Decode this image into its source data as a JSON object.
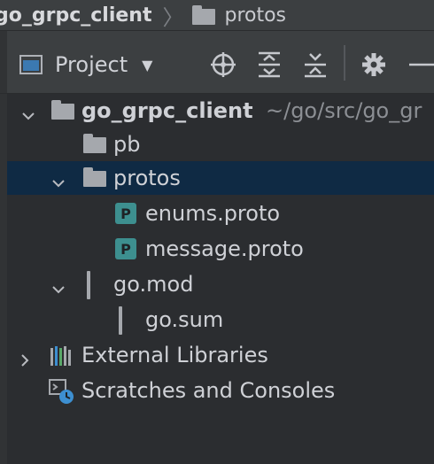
{
  "breadcrumb": {
    "root": "go_grpc_client",
    "current": "protos"
  },
  "toolbar": {
    "project_label": "Project",
    "icons": [
      "locate-icon",
      "expand-all-icon",
      "collapse-all-icon",
      "gear-icon",
      "minimize-icon"
    ]
  },
  "tree": {
    "root_name": "go_grpc_client",
    "root_path": "~/go/src/go_gr",
    "items": {
      "pb": "pb",
      "protos": "protos",
      "enums": "enums.proto",
      "message": "message.proto",
      "gomod": "go.mod",
      "gosum": "go.sum",
      "external": "External Libraries",
      "scratches": "Scratches and Consoles"
    },
    "proto_badge": "P"
  },
  "colors": {
    "selection": "#0f2a44",
    "proto_icon": "#3d8f8f",
    "background": "#2b2d30"
  }
}
